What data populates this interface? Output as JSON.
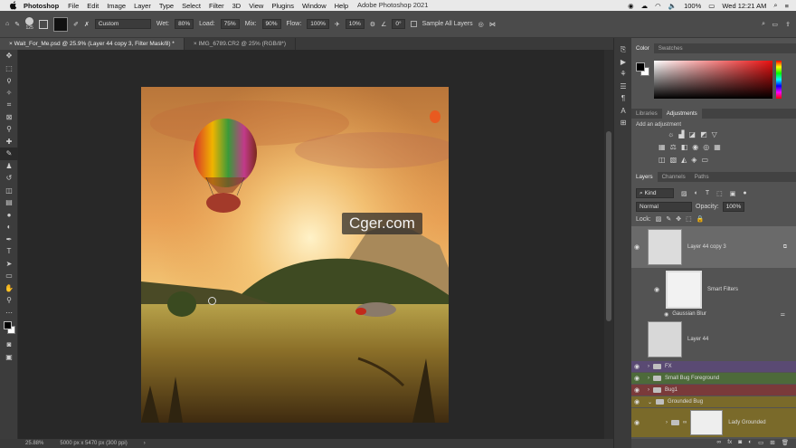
{
  "menubar": {
    "app": "Photoshop",
    "items": [
      "File",
      "Edit",
      "Image",
      "Layer",
      "Type",
      "Select",
      "Filter",
      "3D",
      "View",
      "Plugins",
      "Window",
      "Help"
    ],
    "title": "Adobe Photoshop 2021",
    "battery": "100%",
    "clock": "Wed 12:21 AM"
  },
  "options": {
    "brush_size": "125",
    "preset": "Custom",
    "wet_label": "Wet:",
    "wet": "80%",
    "load_label": "Load:",
    "load": "75%",
    "mix_label": "Mix:",
    "mix": "90%",
    "flow_label": "Flow:",
    "flow": "100%",
    "smoothing": "10%",
    "angle": "0°",
    "sample_all": "Sample All Layers"
  },
  "tabs": [
    {
      "label": "Wait_For_Me.psd @ 25.9% (Layer 44 copy 3, Filter Mask/8) *"
    },
    {
      "label": "IMG_6789.CR2 @ 25% (RGB/8*)"
    }
  ],
  "status": {
    "zoom": "25.88%",
    "doc": "5000 px x 5470 px (300 ppi)"
  },
  "watermark": "Cger.com",
  "color_panel": {
    "tabs": [
      "Color",
      "Swatches"
    ]
  },
  "adjust_panel": {
    "tabs": [
      "Libraries",
      "Adjustments"
    ],
    "hint": "Add an adjustment"
  },
  "layers_panel": {
    "tabs": [
      "Layers",
      "Channels",
      "Paths"
    ],
    "kind": "Kind",
    "blend": "Normal",
    "opacity_label": "Opacity:",
    "opacity": "100%",
    "lock_label": "Lock:",
    "layers": [
      {
        "name": "Layer 44 copy 3"
      },
      {
        "name": "Smart Filters"
      },
      {
        "name": "Gaussian Blur"
      },
      {
        "name": "Layer 44"
      },
      {
        "name": "FX"
      },
      {
        "name": "Small Bug Foreground"
      },
      {
        "name": "Bug1"
      },
      {
        "name": "Grounded Bug"
      },
      {
        "name": "Lady Grounded"
      }
    ]
  },
  "colors": {
    "accent": "#1473e6",
    "fg": "#000000",
    "bg": "#ffffff"
  }
}
